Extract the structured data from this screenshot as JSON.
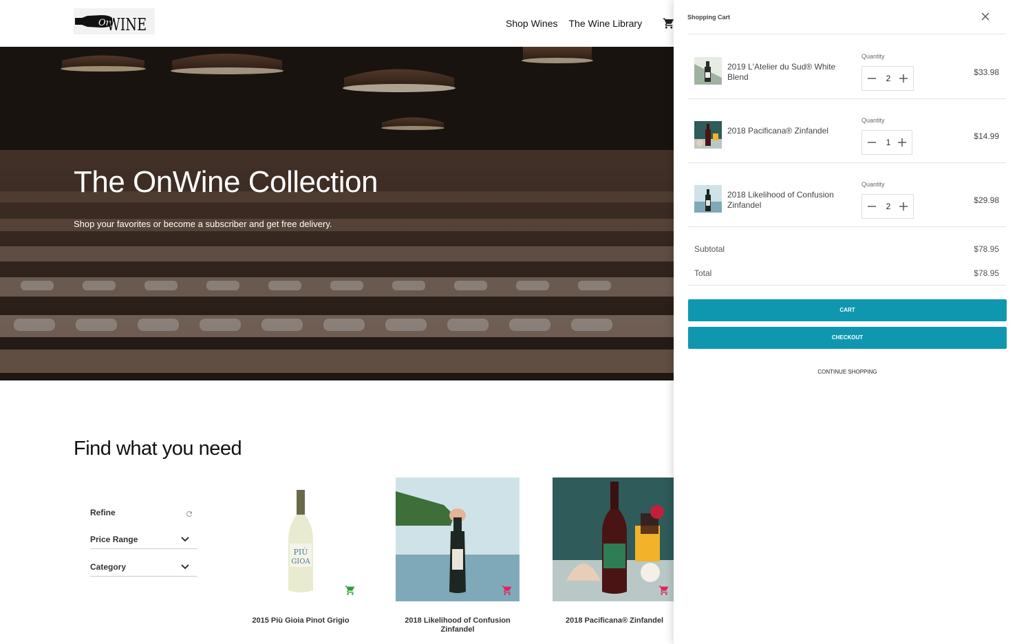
{
  "brand": {
    "logo_text_1": "On",
    "logo_text_2": "WINE"
  },
  "nav": {
    "items": [
      "Shop Wines",
      "The Wine Library"
    ]
  },
  "hero": {
    "title": "The OnWine Collection",
    "subtitle": "Shop your favorites or become a subscriber and get free delivery."
  },
  "find": {
    "title": "Find what you need",
    "refine_label": "Refine",
    "filters": [
      "Price Range",
      "Category"
    ]
  },
  "products": [
    {
      "name": "2015 Più Gioia Pinot Grigio",
      "cart_color": "#2e9e3f"
    },
    {
      "name": "2018 Likelihood of Confusion Zinfandel",
      "cart_color": "#e0245e"
    },
    {
      "name": "2018 Pacificana® Zinfandel",
      "cart_color": "#e0245e"
    }
  ],
  "cart": {
    "title": "Shopping Cart",
    "quantity_label": "Quantity",
    "items": [
      {
        "name": "2019 L'Atelier du Sud® White Blend",
        "qty": "2",
        "price": "$33.98"
      },
      {
        "name": "2018 Pacificana® Zinfandel",
        "qty": "1",
        "price": "$14.99"
      },
      {
        "name": "2018 Likelihood of Confusion Zinfandel",
        "qty": "2",
        "price": "$29.98"
      }
    ],
    "subtotal_label": "Subtotal",
    "subtotal": "$78.95",
    "total_label": "Total",
    "total": "$78.95",
    "cart_button": "CART",
    "checkout_button": "CHECKOUT",
    "continue_label": "CONTINUE SHOPPING",
    "accent": "#0f97b0"
  },
  "icons": {
    "nav_cart": "cart-icon",
    "close": "close-icon",
    "reset": "refresh-icon",
    "chevron": "chevron-down-icon",
    "minus": "minus-icon",
    "plus": "plus-icon"
  }
}
